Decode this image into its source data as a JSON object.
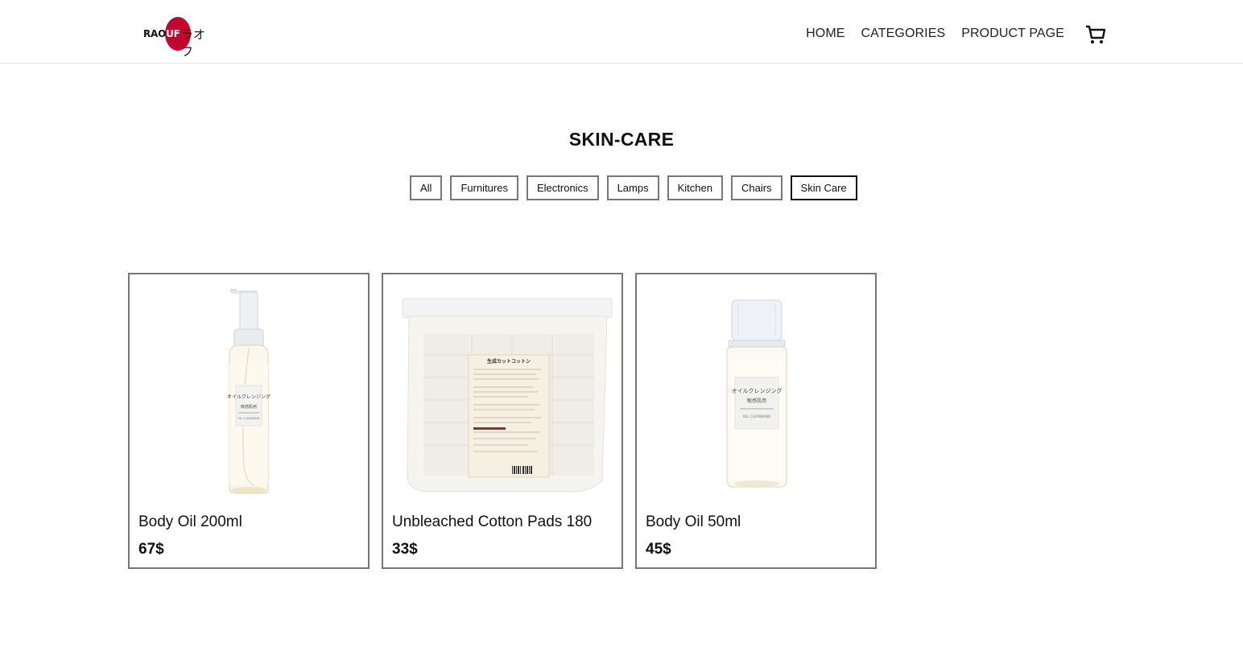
{
  "header": {
    "logo_text_latin_dark": "RAO",
    "logo_text_latin_light": "UF",
    "logo_text_jp": "ラオフ",
    "nav": [
      {
        "label": "HOME"
      },
      {
        "label": "CATEGORIES"
      },
      {
        "label": "PRODUCT PAGE"
      }
    ],
    "cart_icon": "shopping-cart-icon"
  },
  "page": {
    "title": "SKIN-CARE",
    "filters": [
      {
        "label": "All"
      },
      {
        "label": "Furnitures"
      },
      {
        "label": "Electronics"
      },
      {
        "label": "Lamps"
      },
      {
        "label": "Kitchen"
      },
      {
        "label": "Chairs"
      },
      {
        "label": "Skin Care",
        "active": true
      }
    ]
  },
  "products": [
    {
      "name": "Body Oil 200ml",
      "price": "67$",
      "image": "pump-bottle",
      "label_jp": "オイルクレンジング",
      "label_sub": "敏感肌用",
      "label_en": "OIL CLEANSING"
    },
    {
      "name": "Unbleached Cotton Pads 180",
      "price": "33$",
      "image": "cotton-pads-bag",
      "label_jp": "生成カットコットン"
    },
    {
      "name": "Body Oil 50ml",
      "price": "45$",
      "image": "small-bottle",
      "label_jp": "オイルクレンジング",
      "label_sub": "敏感肌用",
      "label_en": "OIL CLEANSING"
    }
  ],
  "colors": {
    "brand_red": "#c4062e",
    "border_gray": "#777777",
    "text": "#111111"
  }
}
